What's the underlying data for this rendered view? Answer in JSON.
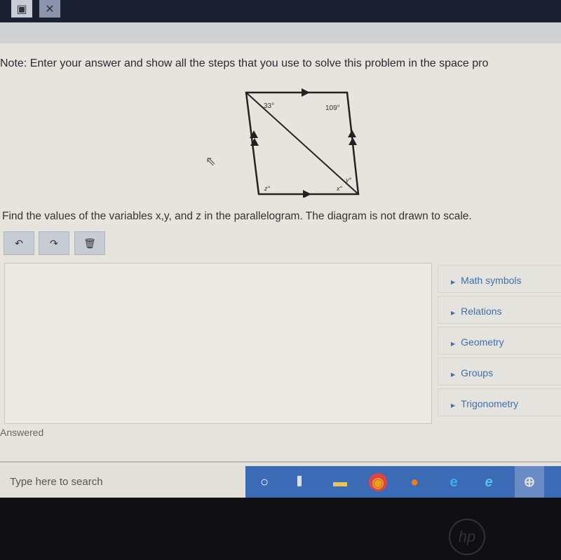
{
  "note": "Note: Enter your answer and show all the steps that you use to solve this problem in the space pro",
  "diagram": {
    "top_left_angle": "33°",
    "top_right_angle": "109°",
    "bottom_left_angle": "z°",
    "bottom_right_lower": "x°",
    "bottom_right_upper": "y°"
  },
  "question": "Find the values of the variables x,y, and z in the parallelogram. The diagram is not drawn to scale.",
  "toolbar": {
    "undo": "↶",
    "redo": "↷",
    "delete": "🗑"
  },
  "categories": [
    "Math symbols",
    "Relations",
    "Geometry",
    "Groups",
    "Trigonometry"
  ],
  "status": "Answered",
  "taskbar": {
    "search_placeholder": "Type here to search"
  },
  "brand": "hp"
}
